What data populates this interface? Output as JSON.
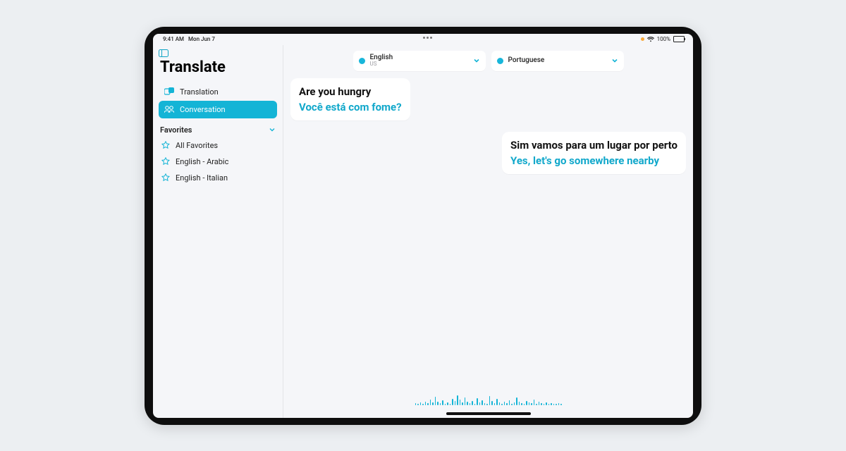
{
  "status": {
    "time": "9:41 AM",
    "date": "Mon Jun 7",
    "battery": "100%"
  },
  "sidebar": {
    "title": "Translate",
    "nav": {
      "translation": "Translation",
      "conversation": "Conversation"
    },
    "favorites_header": "Favorites",
    "favorites": {
      "all": "All Favorites",
      "en_ar": "English - Arabic",
      "en_it": "English - Italian"
    }
  },
  "languages": {
    "left": {
      "name": "English",
      "region": "US"
    },
    "right": {
      "name": "Portuguese",
      "region": ""
    }
  },
  "messages": {
    "m1": {
      "source": "Are you hungry",
      "translation": "Você está com fome?"
    },
    "m2": {
      "source": "Sim vamos para um lugar por perto",
      "translation": "Yes, let's go somewhere nearby"
    }
  },
  "colors": {
    "accent": "#14b4d6",
    "translation": "#11a8cb"
  }
}
